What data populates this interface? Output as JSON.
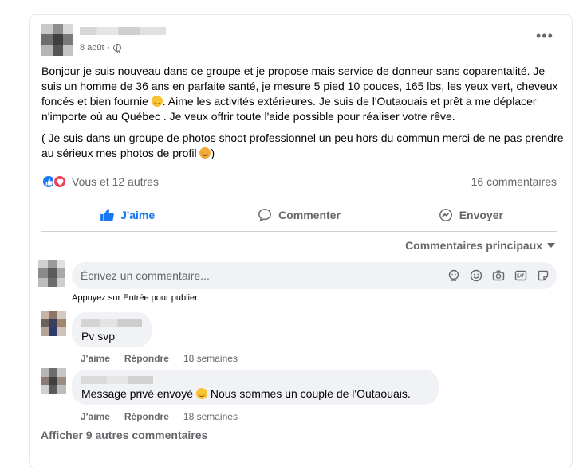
{
  "post": {
    "date": "8 août",
    "paragraph1": "Bonjour je suis nouveau dans ce groupe et je propose mais service de donneur sans coparentalité. Je suis un homme de 36 ans en parfaite santé, je mesure 5 pied 10 pouces, 165 lbs, les yeux vert, cheveux foncés et bien fournie",
    "paragraph1b": ". Aime les activités extérieures. Je suis de l'Outaouais et prêt a me déplacer n'importe où au Québec . Je veux offrir toute l'aide possible pour réaliser votre rêve.",
    "paragraph2": "( Je suis dans un groupe de photos shoot professionnel un peu hors du commun  merci de ne pas prendre au sérieux mes photos de profil",
    "paragraph2b": ")",
    "reactions_text": "Vous et 12 autres",
    "comments_count": "16 commentaires"
  },
  "actions": {
    "like": "J'aime",
    "comment": "Commenter",
    "share": "Envoyer"
  },
  "sort_label": "Commentaires principaux",
  "composer": {
    "placeholder": "Écrivez un commentaire...",
    "hint": "Appuyez sur Entrée pour publier."
  },
  "comments": [
    {
      "text": "Pv svp",
      "like": "J'aime",
      "reply": "Répondre",
      "time": "18 semaines"
    },
    {
      "text": "Message privé envoyé",
      "text_b": "Nous sommes un couple de l'Outaouais.",
      "like": "J'aime",
      "reply": "Répondre",
      "time": "18 semaines"
    }
  ],
  "more_comments": "Afficher 9 autres commentaires",
  "colors": {
    "accent": "#1877f2",
    "muted": "#65676b",
    "bubble": "#f0f2f5",
    "love": "#f33e58"
  },
  "icons": [
    "globe-icon",
    "more-dots-icon",
    "like-reaction-icon",
    "love-reaction-icon",
    "thumbs-up-icon",
    "comment-icon",
    "messenger-icon",
    "sticker-icon",
    "emoji-icon",
    "camera-icon",
    "gif-icon",
    "avatar-sticker-icon"
  ]
}
